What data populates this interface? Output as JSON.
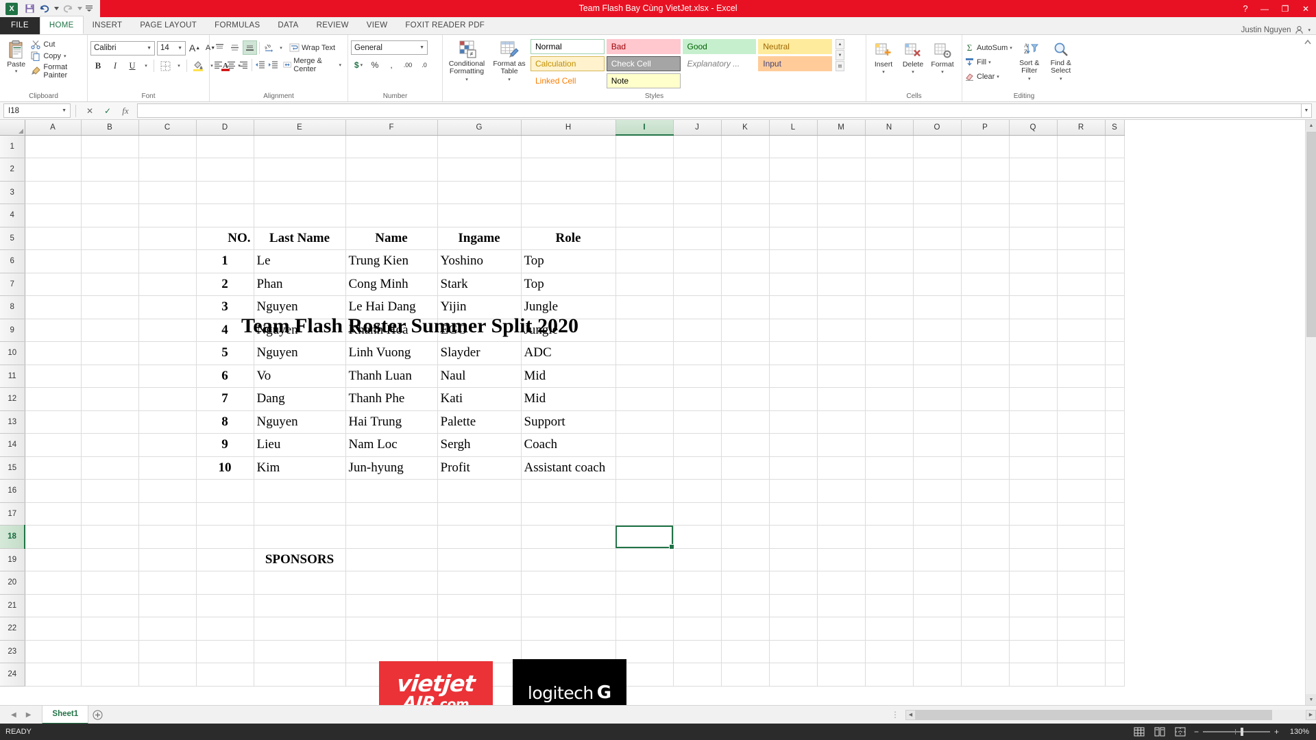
{
  "titlebar": {
    "doc_title": "Team Flash Bay Cùng VietJet.xlsx  -  Excel",
    "save_icon": "save-icon",
    "undo_icon": "undo-icon",
    "redo_icon": "redo-icon",
    "customize_qat_icon": "customize-quick-access-toolbar-icon",
    "help_label": "?",
    "minimize_label": "—",
    "restore_label": "❐",
    "close_label": "✕"
  },
  "tabs": {
    "file": "FILE",
    "items": [
      "HOME",
      "INSERT",
      "PAGE LAYOUT",
      "FORMULAS",
      "DATA",
      "REVIEW",
      "VIEW",
      "FOXIT READER PDF"
    ],
    "active": "HOME",
    "user_name": "Justin Nguyen"
  },
  "ribbon": {
    "clipboard": {
      "group_label": "Clipboard",
      "paste_label": "Paste",
      "cut_label": "Cut",
      "copy_label": "Copy",
      "format_painter_label": "Format Painter"
    },
    "font": {
      "group_label": "Font",
      "font_name": "Calibri",
      "font_size": "14",
      "grow_font_label": "A",
      "shrink_font_label": "A",
      "bold_label": "B",
      "italic_label": "I",
      "underline_label": "U",
      "borders_icon": "borders-icon",
      "fill_color_icon": "fill-color-icon",
      "font_color_icon": "font-color-icon"
    },
    "alignment": {
      "group_label": "Alignment",
      "wrap_text_label": "Wrap Text",
      "merge_center_label": "Merge & Center",
      "orientation_icon": "orientation-icon",
      "indent_decrease_icon": "decrease-indent-icon",
      "indent_increase_icon": "increase-indent-icon"
    },
    "number": {
      "group_label": "Number",
      "format": "General",
      "currency_label": "$",
      "percent_label": "%",
      "comma_label": ",",
      "increase_decimal_label": ".00",
      "decrease_decimal_label": ".0"
    },
    "styles": {
      "group_label": "Styles",
      "conditional_formatting_label": "Conditional Formatting",
      "format_as_table_label": "Format as Table",
      "cells": [
        {
          "label": "Normal",
          "bg": "#ffffff",
          "fg": "#000000",
          "border": "#9fcfb0"
        },
        {
          "label": "Bad",
          "bg": "#ffc7ce",
          "fg": "#9c0006",
          "border": "transparent"
        },
        {
          "label": "Good",
          "bg": "#c6efce",
          "fg": "#006100",
          "border": "transparent"
        },
        {
          "label": "Neutral",
          "bg": "#ffeb9c",
          "fg": "#9c6500",
          "border": "transparent"
        },
        {
          "label": "Calculation",
          "bg": "#fff2cc",
          "fg": "#bf8f00",
          "border": "#d6b656"
        },
        {
          "label": "Check Cell",
          "bg": "#a5a5a5",
          "fg": "#ffffff",
          "border": "#595959"
        },
        {
          "label": "Explanatory ...",
          "bg": "#ffffff",
          "fg": "#7f7f7f",
          "border": "transparent"
        },
        {
          "label": "Input",
          "bg": "#ffcc99",
          "fg": "#3f3f76",
          "border": "transparent"
        },
        {
          "label": "Linked Cell",
          "bg": "#ffffff",
          "fg": "#fa7d00",
          "border": "transparent"
        },
        {
          "label": "Note",
          "bg": "#ffffcc",
          "fg": "#000000",
          "border": "#b2b2b2"
        }
      ]
    },
    "cells": {
      "group_label": "Cells",
      "insert_label": "Insert",
      "delete_label": "Delete",
      "format_label": "Format"
    },
    "editing": {
      "group_label": "Editing",
      "autosum_label": "AutoSum",
      "fill_label": "Fill",
      "clear_label": "Clear",
      "sort_filter_label": "Sort & Filter",
      "find_select_label": "Find & Select"
    }
  },
  "formula_bar": {
    "name_box": "I18",
    "cancel_icon": "cancel-icon",
    "enter_icon": "confirm-icon",
    "function_icon": "insert-function-icon",
    "value": "",
    "placeholder": ""
  },
  "grid": {
    "columns": [
      "A",
      "B",
      "C",
      "D",
      "E",
      "F",
      "G",
      "H",
      "I",
      "J",
      "K",
      "L",
      "M",
      "N",
      "O",
      "P",
      "Q",
      "R",
      "S"
    ],
    "selected_column": "I",
    "selected_row": 18,
    "rows": [
      1,
      2,
      3,
      4,
      5,
      6,
      7,
      8,
      9,
      10,
      11,
      12,
      13,
      14,
      15,
      16,
      17,
      18,
      19,
      20,
      21,
      22,
      23,
      24
    ],
    "title_cell": {
      "text": "Team Flash Roster Summer Split 2020",
      "row": 3
    },
    "headers": {
      "row": 5,
      "no": "NO.",
      "last_name": "Last Name",
      "name": "Name",
      "ingame": "Ingame",
      "role": "Role"
    },
    "roster": [
      {
        "no": "1",
        "last_name": "Le",
        "name": "Trung Kien",
        "ingame": "Yoshino",
        "role": "Top"
      },
      {
        "no": "2",
        "last_name": "Phan",
        "name": "Cong Minh",
        "ingame": "Stark",
        "role": "Top"
      },
      {
        "no": "3",
        "last_name": "Nguyen",
        "name": "Le Hai Dang",
        "ingame": "Yijin",
        "role": "Jungle"
      },
      {
        "no": "4",
        "last_name": "Nguyen",
        "name": "Khanh Hoa",
        "ingame": "EGO",
        "role": "Jungle"
      },
      {
        "no": "5",
        "last_name": "Nguyen",
        "name": "Linh Vuong",
        "ingame": "Slayder",
        "role": "ADC"
      },
      {
        "no": "6",
        "last_name": "Vo",
        "name": "Thanh Luan",
        "ingame": "Naul",
        "role": "Mid"
      },
      {
        "no": "7",
        "last_name": "Dang",
        "name": "Thanh Phe",
        "ingame": "Kati",
        "role": "Mid"
      },
      {
        "no": "8",
        "last_name": "Nguyen",
        "name": "Hai Trung",
        "ingame": "Palette",
        "role": "Support"
      },
      {
        "no": "9",
        "last_name": "Lieu",
        "name": "Nam Loc",
        "ingame": "Sergh",
        "role": "Coach"
      },
      {
        "no": "10",
        "last_name": "Kim",
        "name": "Jun-hyung",
        "ingame": "Profit",
        "role": "Assistant coach"
      }
    ],
    "sponsors": {
      "label": "SPONSORS",
      "label_row": 19,
      "logos": [
        {
          "name": "vietjet-air-logo",
          "line1": "vietjet",
          "line2": "AIR",
          "line3": ".com",
          "bg": "#ea3237",
          "fg": "#ffffff"
        },
        {
          "name": "logitech-logo",
          "line1": "logitech",
          "line2": "G",
          "bg": "#000000",
          "fg": "#ffffff"
        }
      ]
    }
  },
  "sheet_tabs": {
    "prev_icon": "previous-sheet-icon",
    "next_icon": "next-sheet-icon",
    "sheets": [
      "Sheet1"
    ],
    "active": "Sheet1",
    "add_label": "+"
  },
  "status_bar": {
    "state": "READY",
    "normal_view_icon": "normal-view-icon",
    "page_layout_icon": "page-layout-view-icon",
    "page_break_icon": "page-break-preview-icon",
    "zoom_out_label": "−",
    "zoom_in_label": "+",
    "zoom_level": "130%"
  }
}
